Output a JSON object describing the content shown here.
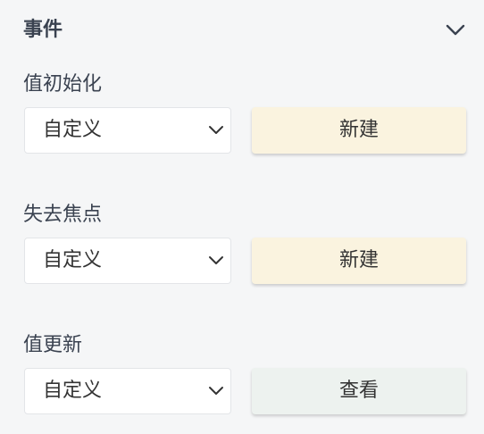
{
  "header": {
    "title": "事件",
    "toggle_icon": "chevron-down-icon"
  },
  "colors": {
    "background": "#f5f6f7",
    "new_button_bg": "#faf3df",
    "view_button_bg": "#edf2ef",
    "text": "#333333"
  },
  "events": [
    {
      "label": "值初始化",
      "select_value": "自定义",
      "button_label": "新建"
    },
    {
      "label": "失去焦点",
      "select_value": "自定义",
      "button_label": "新建"
    },
    {
      "label": "值更新",
      "select_value": "自定义",
      "button_label": "查看"
    }
  ]
}
